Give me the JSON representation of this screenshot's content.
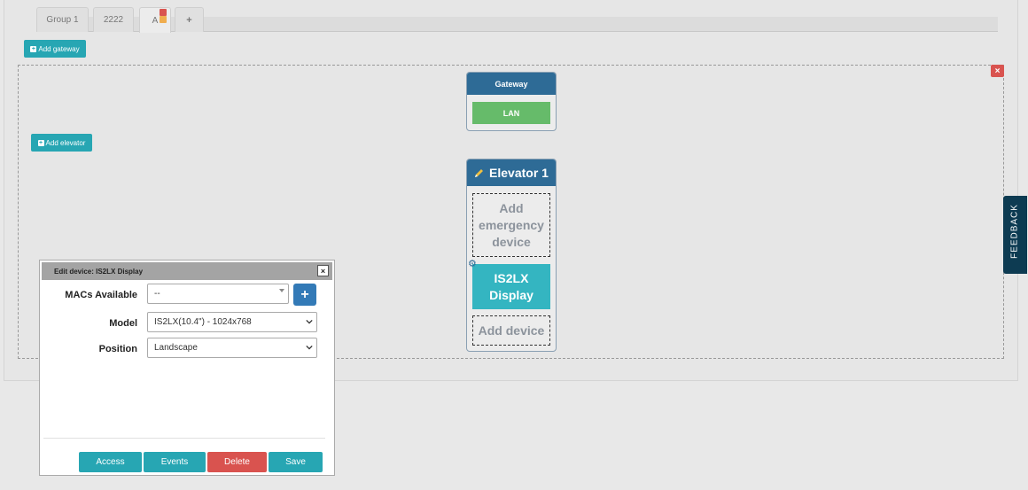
{
  "tabs": [
    {
      "label": "Group 1"
    },
    {
      "label": "2222"
    },
    {
      "label": "A"
    },
    {
      "label": "+"
    }
  ],
  "add_gateway_label": "Add gateway",
  "add_elevator_label": "Add elevator",
  "close_area_label": "×",
  "gateway": {
    "title": "Gateway",
    "lan_label": "LAN"
  },
  "elevator": {
    "title": "Elevator 1",
    "emergency_label": "Add emergency device",
    "device_label": "IS2LX Display",
    "add_device_label": "Add device"
  },
  "feedback_label": "FEEDBACK",
  "modal": {
    "title": "Edit device: IS2LX Display",
    "close_label": "×",
    "macs_label": "MACs Available",
    "macs_value": "--",
    "model_label": "Model",
    "model_value": "IS2LX(10.4\") - 1024x768",
    "position_label": "Position",
    "position_value": "Landscape",
    "add_mac_label": "+",
    "buttons": {
      "access": "Access",
      "events": "Events",
      "delete": "Delete",
      "save": "Save"
    }
  },
  "colors": {
    "teal": "#27a6b3",
    "navy": "#2e6b96",
    "green": "#66bb6a",
    "red": "#d9534f",
    "blue": "#337ab7"
  }
}
